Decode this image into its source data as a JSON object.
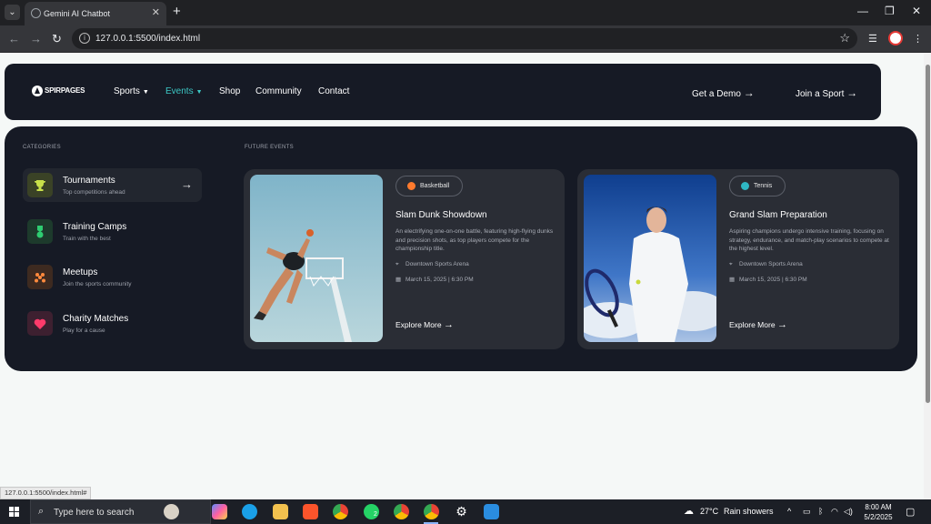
{
  "browser": {
    "tab_title": "Gemini AI Chatbot",
    "url": "127.0.0.1:5500/index.html",
    "status_url": "127.0.0.1:5500/index.html#"
  },
  "site": {
    "logo": "SPIRPAGES",
    "nav": [
      {
        "label": "Sports",
        "dropdown": true,
        "active": false
      },
      {
        "label": "Events",
        "dropdown": true,
        "active": true
      },
      {
        "label": "Shop"
      },
      {
        "label": "Community"
      },
      {
        "label": "Contact"
      }
    ],
    "cta_demo": "Get a Demo",
    "cta_join": "Join a Sport",
    "arrow": "→"
  },
  "menu": {
    "categories_label": "CATEGORIES",
    "future_label": "FUTURE EVENTS",
    "categories": [
      {
        "name": "Tournaments",
        "sub": "Top competitions ahead",
        "icon": "trophy-icon",
        "color": "#c8e04a",
        "bg": "#3a4226"
      },
      {
        "name": "Training Camps",
        "sub": "Train with the best",
        "icon": "medal-icon",
        "color": "#2ecc71",
        "bg": "#1d3a2c"
      },
      {
        "name": "Meetups",
        "sub": "Join the sports community",
        "icon": "group-icon",
        "color": "#ff8a3d",
        "bg": "#3d2a20"
      },
      {
        "name": "Charity Matches",
        "sub": "Play for a cause",
        "icon": "heart-icon",
        "color": "#ff3b6b",
        "bg": "#3d2030"
      }
    ],
    "events": [
      {
        "tag": "Basketball",
        "tag_color": "#ff7a2d",
        "title": "Slam Dunk Showdown",
        "desc": "An electrifying one-on-one battle, featuring high-flying dunks and precision shots, as top players compete for the championship title.",
        "location": "Downtown Sports Arena",
        "date": "March 15, 2025 | 6:30 PM",
        "explore": "Explore More"
      },
      {
        "tag": "Tennis",
        "tag_color": "#2fb7c4",
        "title": "Grand Slam Preparation",
        "desc": "Aspiring champions undergo intensive training, focusing on strategy, endurance, and match-play scenarios to compete at the highest level.",
        "location": "Downtown Sports Arena",
        "date": "March 15, 2025 | 6:30 PM",
        "explore": "Explore More"
      }
    ]
  },
  "taskbar": {
    "search_placeholder": "Type here to search",
    "weather_temp": "27°C",
    "weather_text": "Rain showers",
    "time": "8:00 AM",
    "date": "5/2/2025",
    "whatsapp_badge": "2"
  }
}
